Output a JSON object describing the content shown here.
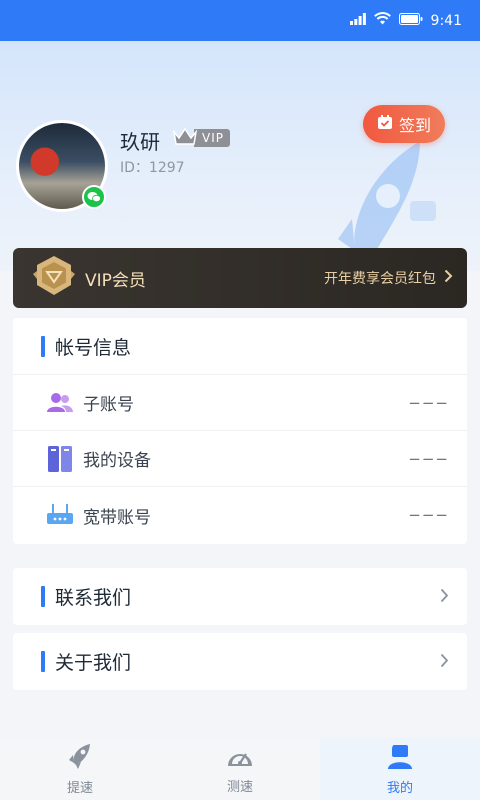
{
  "status_bar": {
    "time": "9:41"
  },
  "profile": {
    "username": "玖研",
    "vip_label": "VIP",
    "user_id": "ID：1297",
    "signin_label": "签到"
  },
  "vip_card": {
    "title": "VIP会员",
    "promo": "开年费享会员红包"
  },
  "account_info": {
    "title": "帐号信息",
    "rows": [
      {
        "icon": "users-icon",
        "label": "子账号",
        "value": "−−−"
      },
      {
        "icon": "devices-icon",
        "label": "我的设备",
        "value": "−−−"
      },
      {
        "icon": "router-icon",
        "label": "宽带账号",
        "value": "−−−"
      }
    ]
  },
  "links": {
    "contact": "联系我们",
    "about": "关于我们"
  },
  "tabbar": {
    "tabs": [
      {
        "label": "提速",
        "icon": "rocket-icon"
      },
      {
        "label": "测速",
        "icon": "speedometer-icon"
      },
      {
        "label": "我的",
        "icon": "profile-icon"
      }
    ],
    "active": "我的"
  },
  "colors": {
    "accent": "#2f7af6",
    "signin": "#f1583f",
    "vip_card_bg": "#2b2722",
    "vip_gold": "#e8cfa4"
  }
}
